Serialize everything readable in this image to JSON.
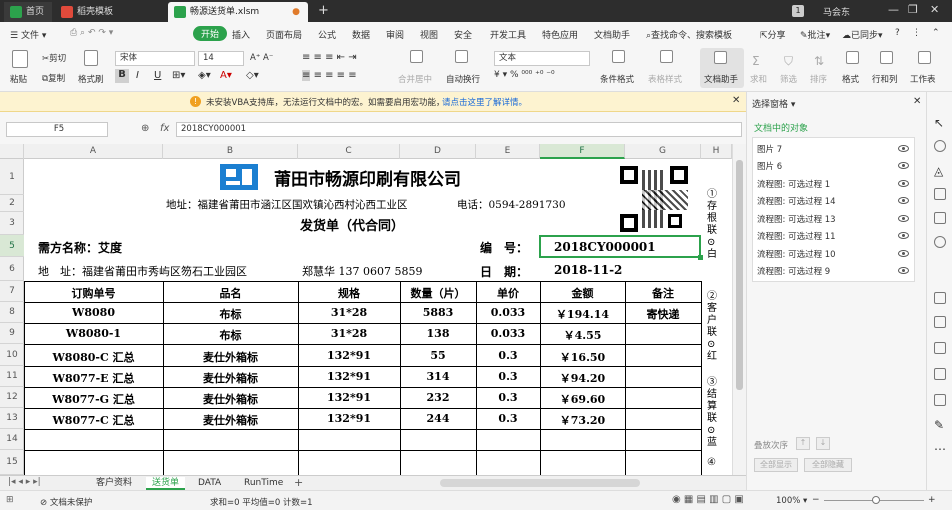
{
  "tabs": [
    {
      "label": "首页"
    },
    {
      "label": "稻壳模板"
    },
    {
      "label": "畅源送货单.xlsm"
    }
  ],
  "add_tab": "+",
  "window_badge": "1",
  "user": "马会东",
  "menu": [
    "文件",
    "开始",
    "插入",
    "页面布局",
    "公式",
    "数据",
    "审阅",
    "视图",
    "安全",
    "开发工具",
    "特色应用",
    "文档助手"
  ],
  "search_label": "查找命令、搜索模板",
  "share": "分享",
  "comment": "批注",
  "sync": "已同步",
  "ribbon": {
    "paste": "粘贴",
    "cut": "剪切",
    "copy": "复制",
    "format_painter": "格式刷",
    "font": "宋体",
    "size": "14",
    "bold": "B",
    "italic": "I",
    "underline": "U",
    "merge": "合并居中",
    "wrap": "自动换行",
    "numfmt": "文本",
    "cond": "条件格式",
    "table_style": "表格样式",
    "doc_helper": "文档助手",
    "sum": "求和",
    "filter": "筛选",
    "sort": "排序",
    "format": "格式",
    "rowcol": "行和列",
    "worksheet": "工作表"
  },
  "warning": {
    "text": "未安装VBA支持库，无法运行文档中的宏。如需要启用宏功能，",
    "link": "请点击这里了解详情。"
  },
  "formula": {
    "cell_ref": "F5",
    "fx": "fx",
    "value": "2018CY000001"
  },
  "columns": [
    "A",
    "B",
    "C",
    "D",
    "E",
    "F",
    "G",
    "H"
  ],
  "rows": [
    "1",
    "2",
    "3",
    "5",
    "6",
    "7",
    "8",
    "9",
    "10",
    "11",
    "12",
    "13",
    "14",
    "15"
  ],
  "doc": {
    "company": "莆田市畅源印刷有限公司",
    "address": "地址：福建省莆田市涵江区国欢镇沁西村沁西工业区",
    "phone": "电话：0594-2891730",
    "title": "发货单（代合同）",
    "buyer": "需方名称：艾度",
    "no_label": "编　号：",
    "no_value": "2018CY000001",
    "addr2": "地　址：福建省莆田市秀屿区笏石工业园区",
    "contact": "郑慧华 137 0607 5859",
    "date_label": "日　期：",
    "date_value": "2018-11-2",
    "headers": [
      "订购单号",
      "品名",
      "规格",
      "数量（片）",
      "单价",
      "金额",
      "备注"
    ],
    "items": [
      {
        "order": "W8080",
        "name": "布标",
        "spec": "31*28",
        "qty": "5883",
        "price": "0.033",
        "amount": "￥194.14",
        "note": "寄快递"
      },
      {
        "order": "W8080-1",
        "name": "布标",
        "spec": "31*28",
        "qty": "138",
        "price": "0.033",
        "amount": "￥4.55",
        "note": ""
      },
      {
        "order": "W8080-C 汇总",
        "name": "麦仕外箱标",
        "spec": "132*91",
        "qty": "55",
        "price": "0.3",
        "amount": "￥16.50",
        "note": ""
      },
      {
        "order": "W8077-E 汇总",
        "name": "麦仕外箱标",
        "spec": "132*91",
        "qty": "314",
        "price": "0.3",
        "amount": "￥94.20",
        "note": ""
      },
      {
        "order": "W8077-G 汇总",
        "name": "麦仕外箱标",
        "spec": "132*91",
        "qty": "232",
        "price": "0.3",
        "amount": "￥69.60",
        "note": ""
      },
      {
        "order": "W8077-C 汇总",
        "name": "麦仕外箱标",
        "spec": "132*91",
        "qty": "244",
        "price": "0.3",
        "amount": "￥73.20",
        "note": ""
      }
    ],
    "side1": "①存根联⊙白",
    "side2": "②客户联⊙红",
    "side3": "③结算联⊙蓝",
    "side4": "④"
  },
  "panel": {
    "header": "选择窗格",
    "subtitle": "文档中的对象",
    "objects": [
      "图片 7",
      "图片 6",
      "流程图: 可选过程 1",
      "流程图: 可选过程 14",
      "流程图: 可选过程 13",
      "流程图: 可选过程 11",
      "流程图: 可选过程 10",
      "流程图: 可选过程 9"
    ],
    "order_label": "叠放次序",
    "show_all": "全部显示",
    "hide_all": "全部隐藏"
  },
  "sheets": [
    "客户资料",
    "送货单",
    "DATA",
    "RunTime"
  ],
  "status": {
    "protect": "文档未保护",
    "stats": "求和=0  平均值=0  计数=1",
    "zoom": "100%"
  },
  "colors": {
    "accent": "#2ca24c",
    "dark": "#2d2d2d"
  }
}
